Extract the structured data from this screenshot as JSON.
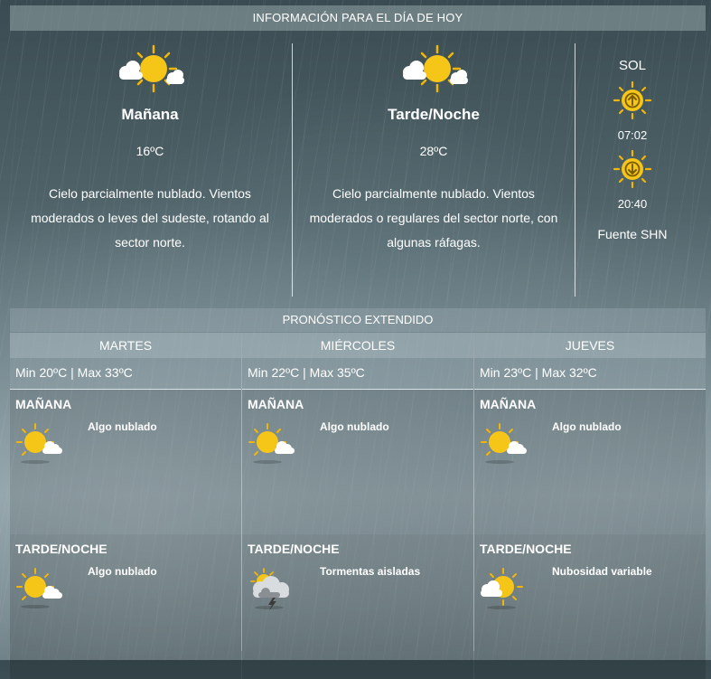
{
  "header": {
    "title": "INFORMACIÓN PARA EL DÍA DE HOY"
  },
  "today": [
    {
      "title": "Mañana",
      "temp": "16ºC",
      "icon": "sun-cloud-icon",
      "desc": "Cielo parcialmente nublado. Vientos moderados o leves del sudeste, rotando al sector norte."
    },
    {
      "title": "Tarde/Noche",
      "temp": "28ºC",
      "icon": "sun-cloud-icon",
      "desc": "Cielo parcialmente nublado. Vientos moderados o regulares del sector norte, con algunas ráfagas."
    }
  ],
  "sun": {
    "title": "SOL",
    "sunrise": "07:02",
    "sunset": "20:40",
    "source": "Fuente SHN"
  },
  "extended": {
    "title": "PRONÓSTICO EXTENDIDO",
    "days": [
      {
        "name": "MARTES",
        "minmax": "Min 20ºC | Max 33ºC",
        "am": {
          "label": "MAÑANA",
          "desc": "Algo nublado",
          "icon": "sun-cloud-icon"
        },
        "pm": {
          "label": "TARDE/NOCHE",
          "desc": "Algo nublado",
          "icon": "sun-cloud-icon"
        }
      },
      {
        "name": "MIÉRCOLES",
        "minmax": "Min 22ºC | Max 35ºC",
        "am": {
          "label": "MAÑANA",
          "desc": "Algo nublado",
          "icon": "sun-cloud-icon"
        },
        "pm": {
          "label": "TARDE/NOCHE",
          "desc": "Tormentas aisladas",
          "icon": "storm-icon"
        }
      },
      {
        "name": "JUEVES",
        "minmax": "Min 23ºC | Max 32ºC",
        "am": {
          "label": "MAÑANA",
          "desc": "Algo nublado",
          "icon": "sun-cloud-icon"
        },
        "pm": {
          "label": "TARDE/NOCHE",
          "desc": "Nubosidad variable",
          "icon": "cloud-sun-icon"
        }
      }
    ]
  },
  "colors": {
    "sun": "#f5c518",
    "sun_ray": "#f2b705",
    "cloud": "#ffffff"
  }
}
